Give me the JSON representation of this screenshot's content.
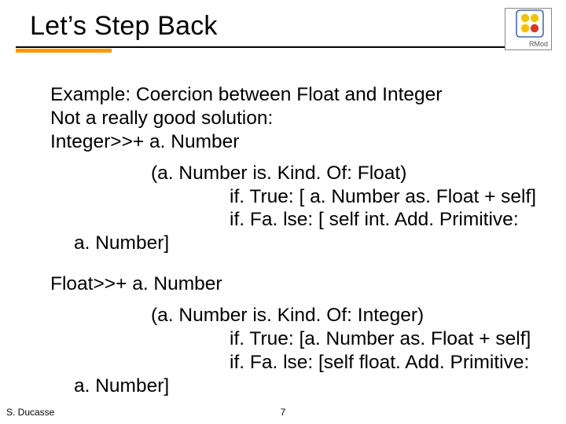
{
  "title": "Let’s Step Back",
  "logo": {
    "label": "RMod"
  },
  "content": {
    "intro": [
      "Example: Coercion between Float and Integer",
      "Not a really good solution:",
      "Integer>>+ a. Number"
    ],
    "block1_test": "(a. Number is. Kind. Of: Float)",
    "block1_true": "if. True: [ a. Number as. Float + self]",
    "block1_false": "if. Fa. lse: [ self int. Add. Primitive:",
    "block1_close": "a. Number]",
    "float_header": "Float>>+ a. Number",
    "block2_test": "(a. Number is. Kind. Of: Integer)",
    "block2_true": "if. True: [a. Number as. Float + self]",
    "block2_false": "if. Fa. lse: [self float. Add. Primitive:",
    "block2_close": "a. Number]"
  },
  "footer": {
    "author": "S. Ducasse",
    "page": "7"
  }
}
